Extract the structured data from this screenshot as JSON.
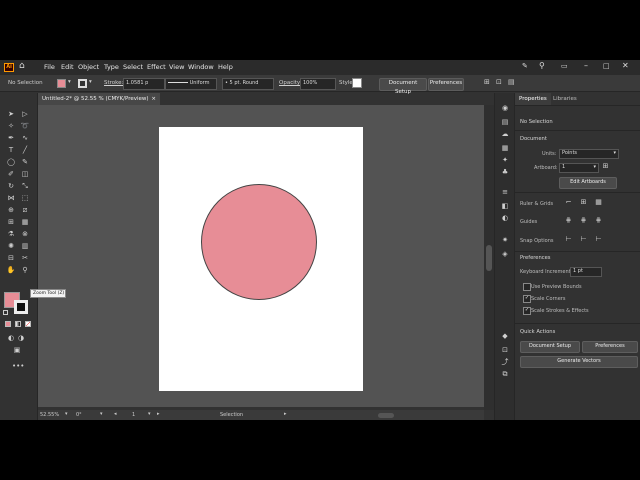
{
  "menu": {
    "app_logo": "Ai",
    "items": [
      "File",
      "Edit",
      "Object",
      "Type",
      "Select",
      "Effect",
      "View",
      "Window",
      "Help"
    ]
  },
  "control_bar": {
    "selection_status": "No Selection",
    "stroke_label": "Stroke:",
    "stroke_value": "1.0581 p",
    "stroke_style": "Uniform",
    "brush_value": "5 pt. Round",
    "opacity_label": "Opacity:",
    "opacity_value": "100%",
    "style_label": "Style:",
    "document_setup": "Document Setup",
    "preferences": "Preferences"
  },
  "document_tab": {
    "title": "Untitled-2* @ 52.55 % (CMYK/Preview)",
    "close": "×"
  },
  "tooltip": "Zoom Tool (Z)",
  "status_bar": {
    "zoom": "52.55%",
    "rotation": "0°",
    "artboard": "1",
    "tool": "Selection"
  },
  "properties": {
    "tabs": [
      "Properties",
      "Libraries"
    ],
    "selection": "No Selection",
    "document_heading": "Document",
    "units_label": "Units:",
    "units_value": "Points",
    "artboard_label": "Artboard:",
    "artboard_value": "1",
    "edit_artboards": "Edit Artboards",
    "rulers_grids": "Ruler & Grids",
    "guides": "Guides",
    "snap_options": "Snap Options",
    "preferences_heading": "Preferences",
    "keyboard_increment_label": "Keyboard Increment:",
    "keyboard_increment_value": "1 pt",
    "use_preview_bounds": "Use Preview Bounds",
    "scale_corners": "Scale Corners",
    "scale_strokes": "Scale Strokes & Effects",
    "quick_actions": "Quick Actions",
    "document_setup_btn": "Document Setup",
    "preferences_btn": "Preferences",
    "generate_vectors": "Generate Vectors"
  },
  "colors": {
    "fill": "#e78d96",
    "accent": "#ff9a00"
  }
}
